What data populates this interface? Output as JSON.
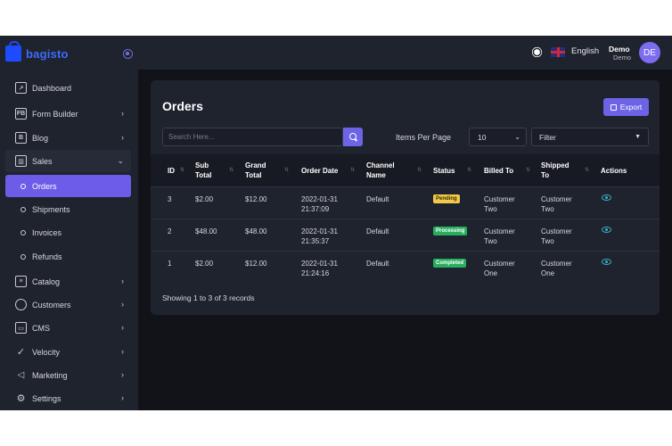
{
  "brand": {
    "name": "bagisto"
  },
  "sidebar": {
    "items": [
      {
        "label": "Dashboard",
        "icon": "dashboard-icon"
      },
      {
        "label": "Form Builder",
        "icon": "form-builder-icon",
        "expandable": true
      },
      {
        "label": "Blog",
        "icon": "blog-icon",
        "expandable": true
      },
      {
        "label": "Sales",
        "icon": "sales-icon",
        "expanded": true
      },
      {
        "label": "Catalog",
        "icon": "catalog-icon",
        "expandable": true
      },
      {
        "label": "Customers",
        "icon": "customers-icon",
        "expandable": true
      },
      {
        "label": "CMS",
        "icon": "cms-icon",
        "expandable": true
      },
      {
        "label": "Velocity",
        "icon": "velocity-icon",
        "expandable": true
      },
      {
        "label": "Marketing",
        "icon": "marketing-icon",
        "expandable": true
      },
      {
        "label": "Settings",
        "icon": "settings-icon",
        "expandable": true
      }
    ],
    "sales_sub": [
      {
        "label": "Orders",
        "active": true
      },
      {
        "label": "Shipments"
      },
      {
        "label": "Invoices"
      },
      {
        "label": "Refunds"
      }
    ]
  },
  "header": {
    "language": "English",
    "user_name": "Demo",
    "user_role": "Demo",
    "avatar_initials": "DE"
  },
  "orders": {
    "title": "Orders",
    "export_label": "Export",
    "search_placeholder": "Search Here...",
    "items_per_page_label": "Items Per Page",
    "items_per_page_value": "10",
    "filter_label": "Filter",
    "columns": [
      "ID",
      "Sub Total",
      "Grand Total",
      "Order Date",
      "Channel Name",
      "Status",
      "Billed To",
      "Shipped To",
      "Actions"
    ],
    "rows": [
      {
        "id": "3",
        "sub_total": "$2.00",
        "grand_total": "$12.00",
        "date": "2022-01-31",
        "time": "21:37:09",
        "channel": "Default",
        "status": "Pending",
        "billed_1": "Customer",
        "billed_2": "Two",
        "shipped_1": "Customer",
        "shipped_2": "Two"
      },
      {
        "id": "2",
        "sub_total": "$48.00",
        "grand_total": "$48.00",
        "date": "2022-01-31",
        "time": "21:35:37",
        "channel": "Default",
        "status": "Processing",
        "billed_1": "Customer",
        "billed_2": "Two",
        "shipped_1": "Customer",
        "shipped_2": "Two"
      },
      {
        "id": "1",
        "sub_total": "$2.00",
        "grand_total": "$12.00",
        "date": "2022-01-31",
        "time": "21:24:16",
        "channel": "Default",
        "status": "Completed",
        "billed_1": "Customer",
        "billed_2": "One",
        "shipped_1": "Customer",
        "shipped_2": "One"
      }
    ],
    "summary": "Showing 1 to 3 of 3 records"
  },
  "colors": {
    "accent": "#6c63e6",
    "pending": "#f2c94c",
    "success": "#27ae60"
  }
}
